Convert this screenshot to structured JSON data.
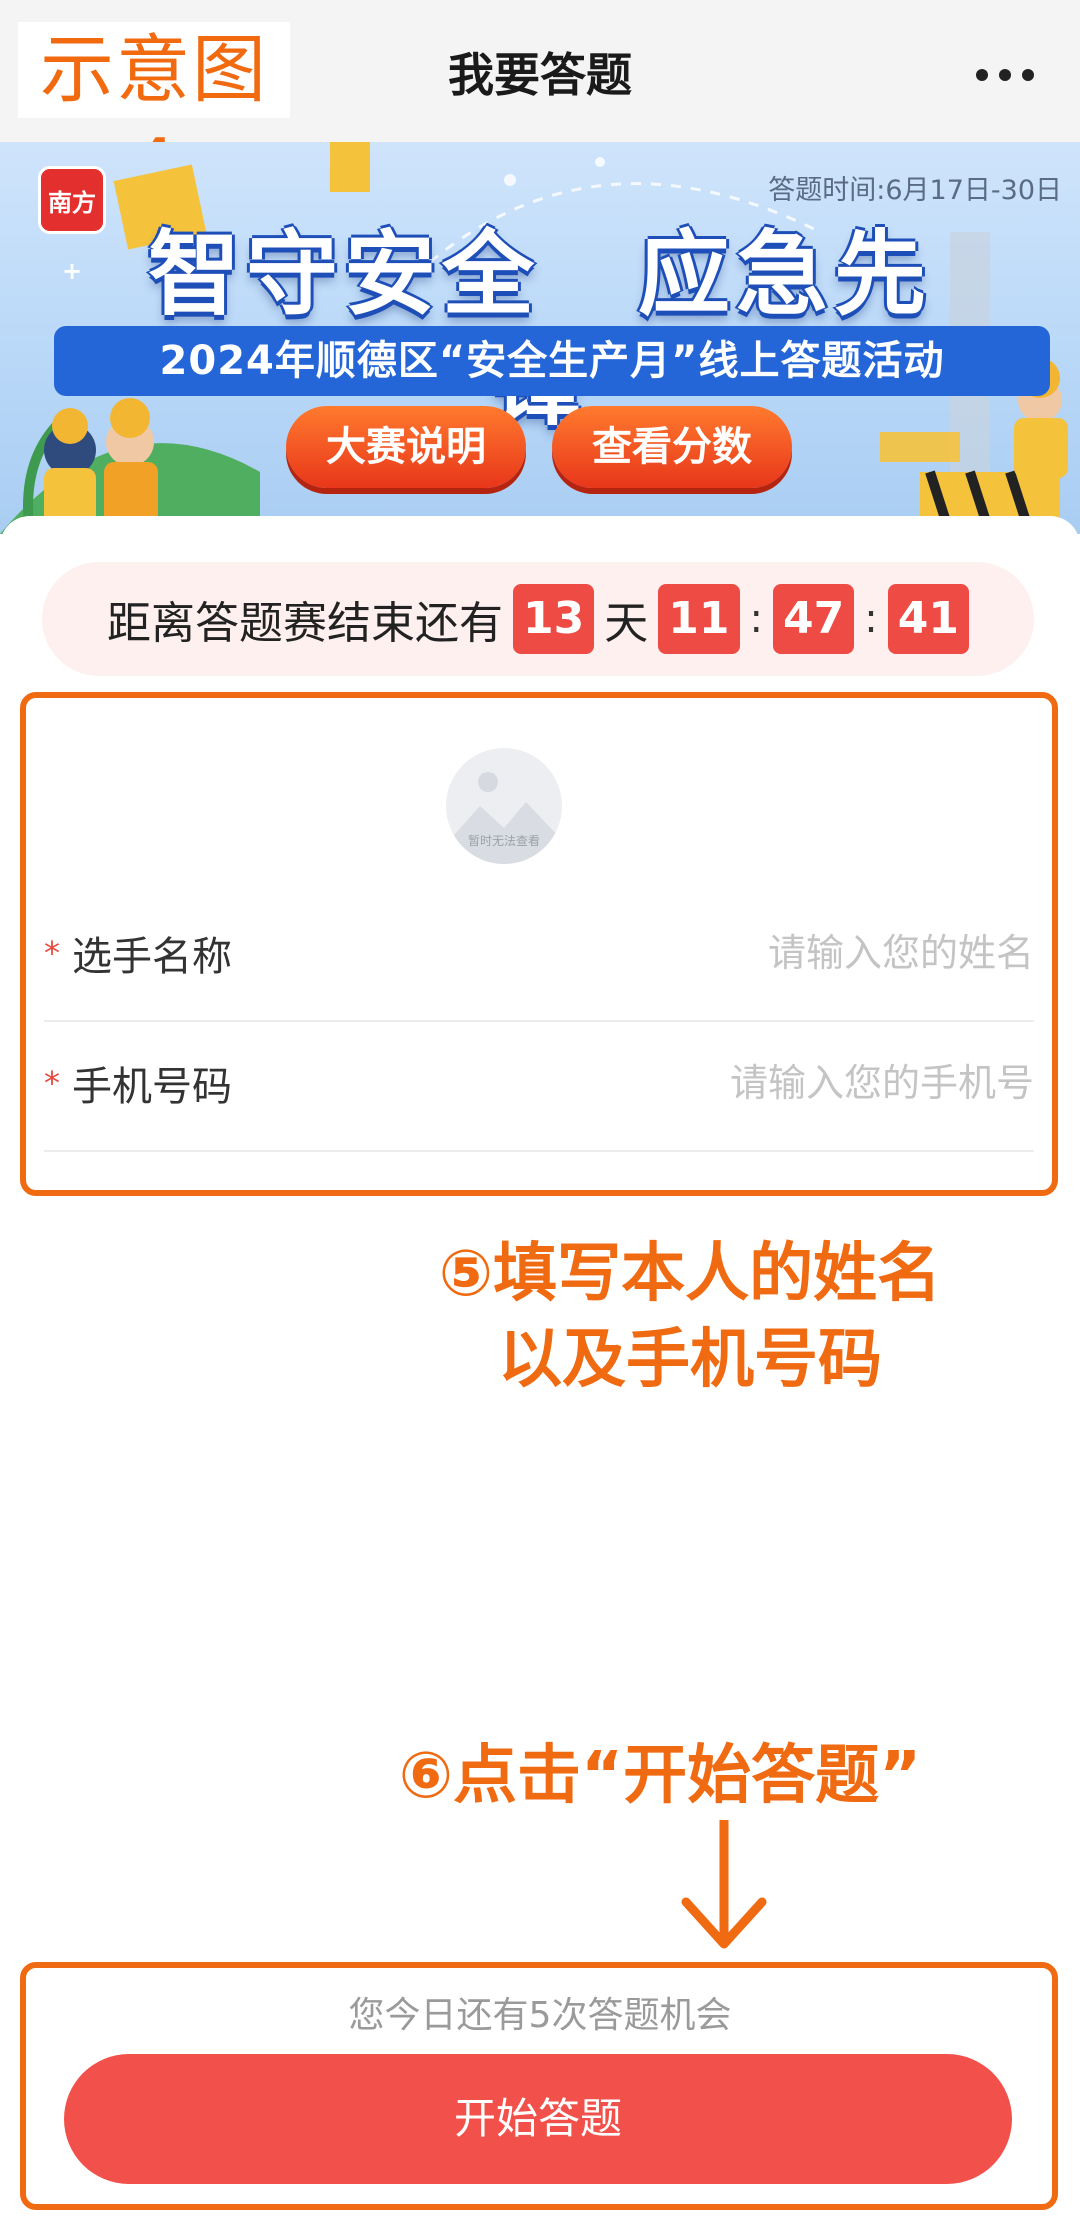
{
  "tag": "示意图4",
  "header": {
    "title": "我要答题",
    "more_icon": "ellipsis-icon"
  },
  "banner": {
    "logo": "南方+",
    "time": "答题时间:6月17日-30日",
    "headline": "智守安全　应急先锋",
    "subline": "2024年顺德区“安全生产月”线上答题活动",
    "btn_rules": "大赛说明",
    "btn_scores": "查看分数"
  },
  "countdown": {
    "prefix": "距离答题赛结束还有",
    "days": "13",
    "days_unit": "天",
    "hours": "11",
    "minutes": "47",
    "seconds": "41",
    "sep": ":"
  },
  "avatar": {
    "note": "暂时无法查看"
  },
  "form": {
    "required_mark": "*",
    "name_label": "选手名称",
    "name_placeholder": "请输入您的姓名",
    "phone_label": "手机号码",
    "phone_placeholder": "请输入您的手机号"
  },
  "annotations": {
    "step5_line1": "⑤填写本人的姓名",
    "step5_line2": "以及手机号码",
    "step6": "⑥点击“开始答题”"
  },
  "footer": {
    "chances": "您今日还有5次答题机会",
    "start_label": "开始答题"
  },
  "colors": {
    "accent": "#f06a12",
    "primary": "#f2514b",
    "countdown_box": "#ee4b45"
  }
}
